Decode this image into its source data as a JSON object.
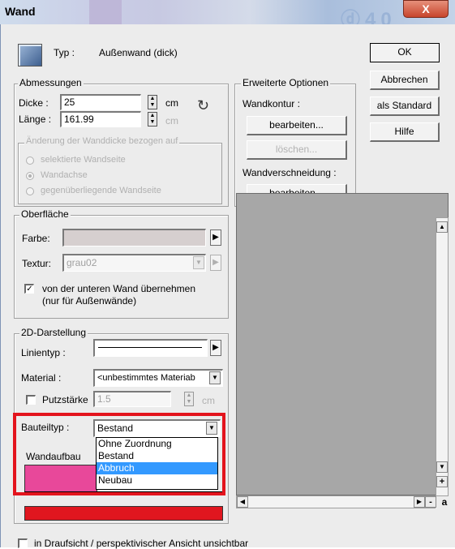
{
  "window": {
    "title": "Wand",
    "close_symbol": "X"
  },
  "header": {
    "type_label": "Typ :",
    "type_value": "Außenwand (dick)"
  },
  "buttons": {
    "ok": "OK",
    "cancel": "Abbrechen",
    "as_default": "als Standard",
    "help": "Hilfe"
  },
  "abmessungen": {
    "title": "Abmessungen",
    "thickness_label": "Dicke :",
    "thickness_value": "25",
    "thickness_unit": "cm",
    "length_label": "Länge :",
    "length_value": "161.99",
    "length_unit": "cm"
  },
  "change_group": {
    "title": "Änderung der Wanddicke bezogen auf",
    "options": [
      "selektierte Wandseite",
      "Wandachse",
      "gegenüberliegende Wandseite"
    ],
    "selected_index": 1
  },
  "extended_options": {
    "title": "Erweiterte Optionen",
    "contour_label": "Wandkontur :",
    "contour_edit": "bearbeiten...",
    "contour_delete": "löschen...",
    "intersect_label": "Wandverschneidung :",
    "intersect_edit": "bearbeiten..."
  },
  "surface": {
    "title": "Oberfläche",
    "color_label": "Farbe:",
    "texture_label": "Textur:",
    "texture_value": "grau02",
    "inherit_checked": true,
    "inherit_line1": "von der unteren Wand übernehmen",
    "inherit_line2": "(nur für Außenwände)"
  },
  "darstellung": {
    "title": "2D-Darstellung",
    "linetype_label": "Linientyp :",
    "material_label": "Material :",
    "material_value": "<unbestimmtes Materiab",
    "plaster_label": "Putzstärke",
    "plaster_value": "1.5",
    "plaster_unit": "cm",
    "plaster_checked": false,
    "component_label": "Bauteiltyp :",
    "component_value": "Bestand",
    "wall_build_label": "Wandaufbau",
    "component_options": [
      "Ohne Zuordnung",
      "Bestand",
      "Abbruch",
      "Neubau"
    ],
    "component_highlight_index": 2
  },
  "footer": {
    "invisible_label": "in Draufsicht / perspektivischer Ansicht unsichtbar"
  },
  "colors": {
    "accent_red": "#e3141d",
    "layer_pink": "#e8489a",
    "layer_red": "#e0161f",
    "selection_blue": "#3399ff",
    "preview_gray": "#a7a7a7"
  },
  "icons": [
    "wall-type-icon",
    "swap-arrow-icon",
    "right-arrow-icon",
    "dropdown-arrow-icon",
    "scroll-arrow-icon"
  ]
}
